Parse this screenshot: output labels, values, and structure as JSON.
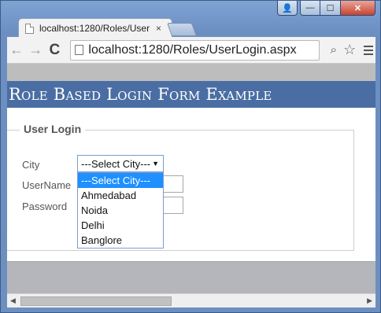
{
  "window": {
    "controls": {
      "user": "👤",
      "minimize": "—",
      "maximize": "☐",
      "close": "✕"
    }
  },
  "tab": {
    "title": "localhost:1280/Roles/User",
    "close": "×"
  },
  "toolbar": {
    "back": "←",
    "forward": "→",
    "reload": "C",
    "url": "localhost:1280/Roles/UserLogin.aspx",
    "zoom": "⌕",
    "star": "☆"
  },
  "page": {
    "banner_title": "Role Based Login Form Example",
    "legend": "User Login",
    "labels": {
      "city": "City",
      "username": "UserName",
      "password": "Password"
    },
    "city_select": {
      "value": "---Select City---",
      "options": [
        "---Select City---",
        "Ahmedabad",
        "Noida",
        "Delhi",
        "Banglore"
      ]
    }
  },
  "scrollbar": {
    "left": "◀",
    "right": "▶"
  }
}
